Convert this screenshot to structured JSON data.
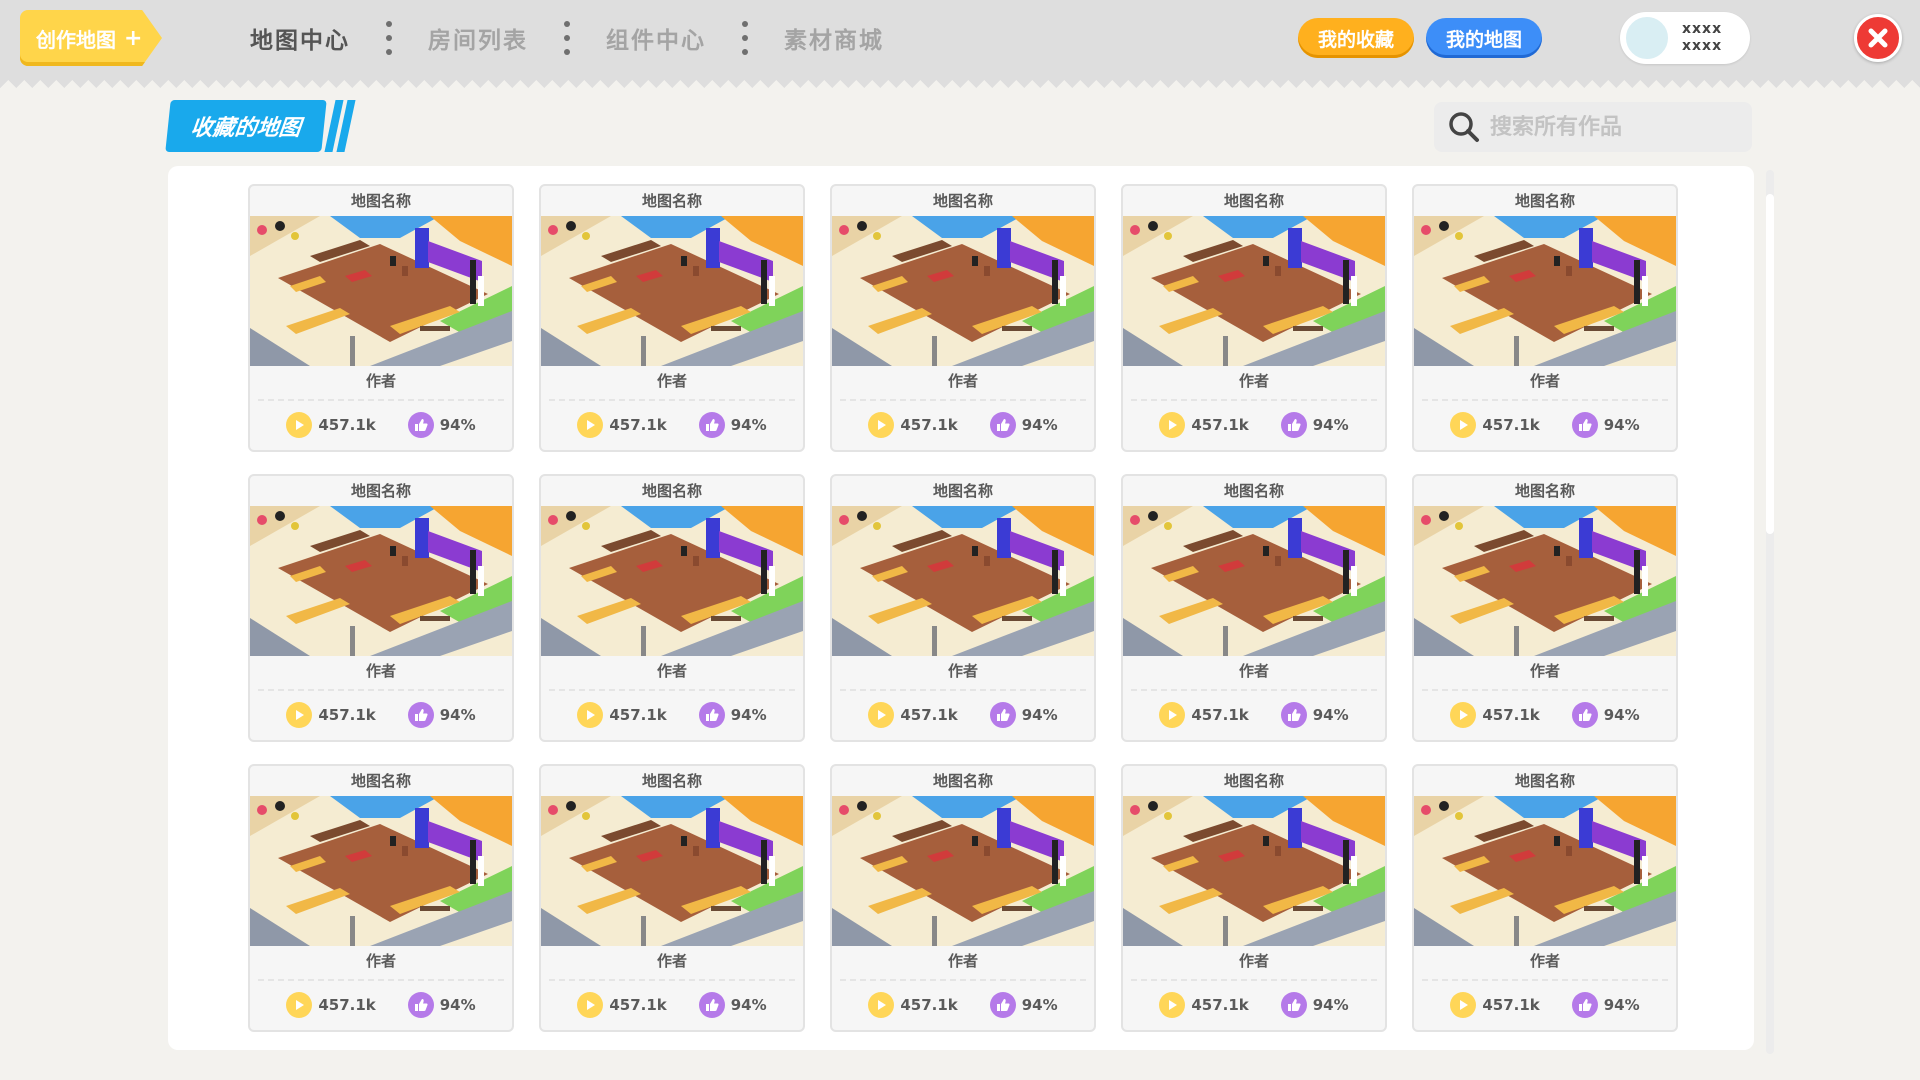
{
  "header": {
    "create_label": "创作地图",
    "create_plus": "+",
    "nav": [
      "地图中心",
      "房间列表",
      "组件中心",
      "素材商城"
    ],
    "favorites_label": "我的收藏",
    "my_maps_label": "我的地图",
    "user": {
      "line1": "xxxx",
      "line2": "xxxx"
    }
  },
  "section": {
    "title": "收藏的地图"
  },
  "search": {
    "placeholder": "搜索所有作品"
  },
  "cards": [
    {
      "name": "地图名称",
      "author": "作者",
      "plays": "457.1k",
      "likes": "94%"
    },
    {
      "name": "地图名称",
      "author": "作者",
      "plays": "457.1k",
      "likes": "94%"
    },
    {
      "name": "地图名称",
      "author": "作者",
      "plays": "457.1k",
      "likes": "94%"
    },
    {
      "name": "地图名称",
      "author": "作者",
      "plays": "457.1k",
      "likes": "94%"
    },
    {
      "name": "地图名称",
      "author": "作者",
      "plays": "457.1k",
      "likes": "94%"
    },
    {
      "name": "地图名称",
      "author": "作者",
      "plays": "457.1k",
      "likes": "94%"
    },
    {
      "name": "地图名称",
      "author": "作者",
      "plays": "457.1k",
      "likes": "94%"
    },
    {
      "name": "地图名称",
      "author": "作者",
      "plays": "457.1k",
      "likes": "94%"
    },
    {
      "name": "地图名称",
      "author": "作者",
      "plays": "457.1k",
      "likes": "94%"
    },
    {
      "name": "地图名称",
      "author": "作者",
      "plays": "457.1k",
      "likes": "94%"
    },
    {
      "name": "地图名称",
      "author": "作者",
      "plays": "457.1k",
      "likes": "94%"
    },
    {
      "name": "地图名称",
      "author": "作者",
      "plays": "457.1k",
      "likes": "94%"
    },
    {
      "name": "地图名称",
      "author": "作者",
      "plays": "457.1k",
      "likes": "94%"
    },
    {
      "name": "地图名称",
      "author": "作者",
      "plays": "457.1k",
      "likes": "94%"
    },
    {
      "name": "地图名称",
      "author": "作者",
      "plays": "457.1k",
      "likes": "94%"
    }
  ],
  "colors": {
    "create": "#ffd54a",
    "favorites": "#ffb01e",
    "my_maps": "#3d8ef8",
    "section": "#19a9ec",
    "close": "#ee3a35",
    "play": "#ffd658",
    "like": "#b57ae9"
  },
  "icons": [
    "plus-icon",
    "search-icon",
    "close-icon",
    "play-icon",
    "thumbs-up-icon"
  ]
}
